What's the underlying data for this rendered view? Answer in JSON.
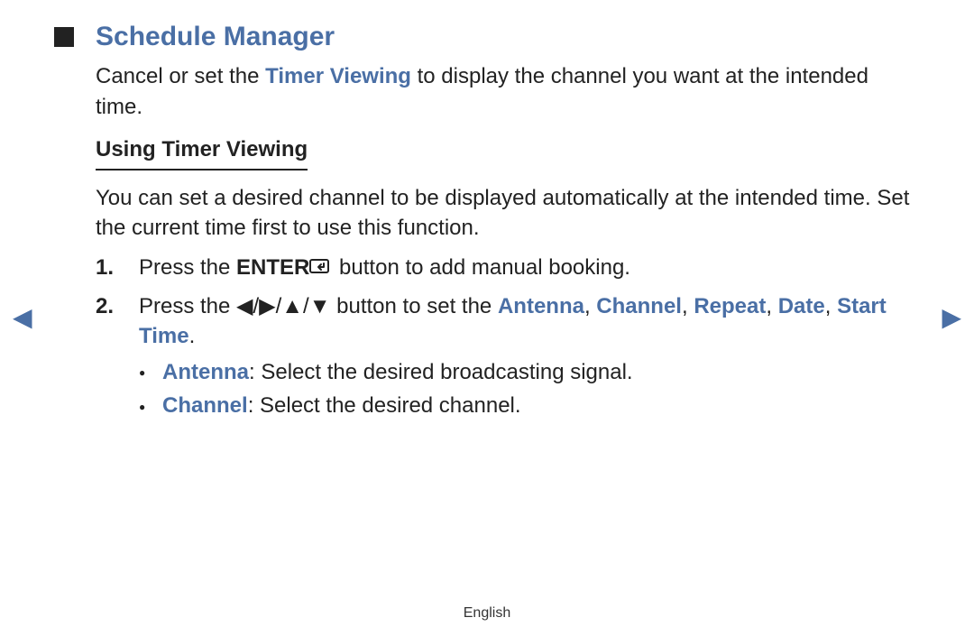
{
  "title": "Schedule Manager",
  "intro": {
    "pre": "Cancel or set the ",
    "timer_viewing": "Timer Viewing",
    "post": " to display the channel you want at the intended time."
  },
  "subheading": "Using Timer Viewing",
  "para2": "You can set a desired channel to be displayed automatically at the intended time. Set the current time first to use this function.",
  "steps": {
    "s1": {
      "num": "1.",
      "pre": "Press the ",
      "enter": "ENTER",
      "post": " button to add manual booking."
    },
    "s2": {
      "num": "2.",
      "pre": "Press the ",
      "arrows": "◀/▶/▲/▼",
      "mid": " button to set the ",
      "antenna": "Antenna",
      "c1": ", ",
      "channel": "Channel",
      "c2": ", ",
      "repeat": "Repeat",
      "c3": ", ",
      "date": "Date",
      "c4": ", ",
      "start_time": "Start Time",
      "period": ".",
      "bullets": {
        "b1": {
          "label": "Antenna",
          "text": ": Select the desired broadcasting signal."
        },
        "b2": {
          "label": "Channel",
          "text": ": Select the desired channel."
        }
      }
    }
  },
  "nav": {
    "left": "◀",
    "right": "▶"
  },
  "footer": "English"
}
